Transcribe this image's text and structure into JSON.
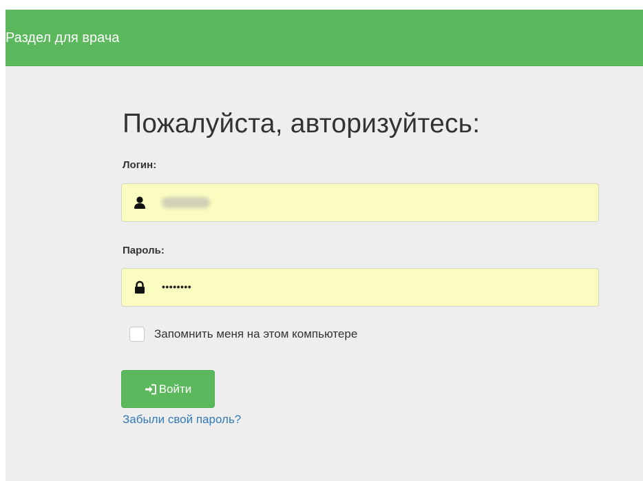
{
  "header": {
    "title": "Раздел для врача",
    "color": "#5cb85c"
  },
  "login_form": {
    "title": "Пожалуйста, авторизуйтесь:",
    "login_label": "Логин:",
    "login_icon": "user-icon",
    "login_value_blurred": true,
    "password_label": "Пароль:",
    "password_icon": "lock-icon",
    "password_value": "••••••••",
    "input_background": "#fbfcc0",
    "remember_label": "Запомнить меня на этом компьютере",
    "remember_checked": false,
    "submit_label": "Войти",
    "submit_icon": "sign-in-icon",
    "submit_color": "#5cb85c",
    "forgot_password_link": "Забыли свой пароль?",
    "link_color": "#337ab7"
  }
}
